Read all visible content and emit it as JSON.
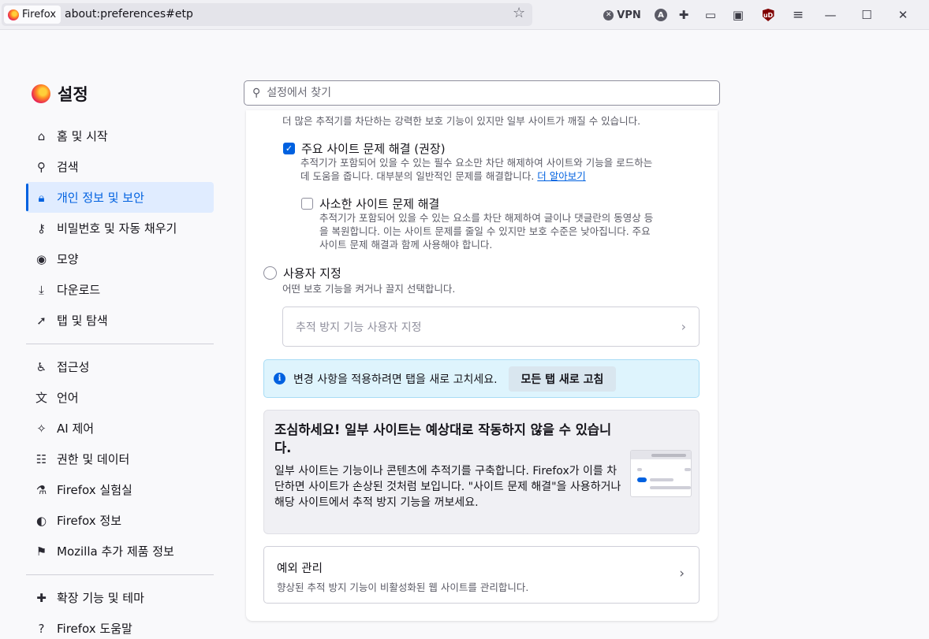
{
  "browser": {
    "identity_label": "Firefox",
    "url": "about:preferences#etp",
    "toolbar": {
      "vpn_label": "VPN",
      "account_initial": "A",
      "ublock_label": "uD"
    },
    "window": {
      "minimize": "—",
      "maximize": "☐",
      "close": "✕"
    }
  },
  "sidebar": {
    "title": "설정",
    "items_top": [
      {
        "label": "홈 및 시작",
        "icon": "home-icon"
      },
      {
        "label": "검색",
        "icon": "search-icon"
      },
      {
        "label": "개인 정보 및 보안",
        "icon": "lock-icon",
        "active": true
      },
      {
        "label": "비밀번호 및 자동 채우기",
        "icon": "key-icon"
      },
      {
        "label": "모양",
        "icon": "eye-icon"
      },
      {
        "label": "다운로드",
        "icon": "download-icon"
      },
      {
        "label": "탭 및 탐색",
        "icon": "cursor-icon"
      }
    ],
    "items_mid": [
      {
        "label": "접근성",
        "icon": "accessibility-icon"
      },
      {
        "label": "언어",
        "icon": "translate-icon"
      },
      {
        "label": "AI 제어",
        "icon": "sparkle-icon"
      },
      {
        "label": "권한 및 데이터",
        "icon": "sliders-icon"
      },
      {
        "label": "Firefox 실험실",
        "icon": "flask-icon"
      },
      {
        "label": "Firefox 정보",
        "icon": "firefox-icon"
      },
      {
        "label": "Mozilla 추가 제품 정보",
        "icon": "mozilla-icon"
      }
    ],
    "items_bottom": [
      {
        "label": "확장 기능 및 테마",
        "icon": "puzzle-icon"
      },
      {
        "label": "Firefox 도움말",
        "icon": "help-icon"
      }
    ]
  },
  "search": {
    "placeholder": "설정에서 찾기"
  },
  "content": {
    "strict_desc": "더 많은 추적기를 차단하는 강력한 보호 기능이 있지만 일부 사이트가 깨질 수 있습니다.",
    "major_fix": {
      "label": "주요 사이트 문제 해결 (권장)",
      "checked": true,
      "desc_line1": "추적기가 포함되어 있을 수 있는 필수 요소만 차단 해제하여 사이트와 기능을 로드하는",
      "desc_line2": "데 도움을 줍니다. 대부분의 일반적인 문제를 해결합니다.",
      "link": "더 알아보기"
    },
    "minor_fix": {
      "label": "사소한 사이트 문제 해결",
      "checked": false,
      "desc_line1": "추적기가 포함되어 있을 수 있는 요소를 차단 해제하여 글이나 댓글란의 동영상 등",
      "desc_line2": "을 복원합니다. 이는 사이트 문제를 줄일 수 있지만 보호 수준은 낮아집니다. 주요",
      "desc_line3": "사이트 문제 해결과 함께 사용해야 합니다."
    },
    "custom": {
      "label": "사용자 지정",
      "desc": "어떤 보호 기능을 켜거나 끌지 선택합니다.",
      "box_label": "추적 방지 기능 사용자 지정"
    },
    "info_bar": {
      "text": "변경 사항을 적용하려면 탭을 새로 고치세요.",
      "button": "모든 탭 새로 고침"
    },
    "warning": {
      "title": "조심하세요! 일부 사이트는 예상대로 작동하지 않을 수 있습니다.",
      "body": "일부 사이트는 기능이나 콘텐츠에 추적기를 구축합니다. Firefox가 이를 차단하면 사이트가 손상된 것처럼 보입니다. \"사이트 문제 해결\"을 사용하거나 해당 사이트에서 추적 방지 기능을 꺼보세요."
    },
    "exceptions": {
      "title": "예외 관리",
      "desc": "향상된 추적 방지 기능이 비활성화된 웹 사이트를 관리합니다."
    }
  },
  "icons": {
    "home-icon": "⌂",
    "search-icon": "⚲",
    "lock-icon": "🔒︎",
    "key-icon": "⚷",
    "eye-icon": "◉",
    "download-icon": "⤓",
    "cursor-icon": "➚",
    "accessibility-icon": "♿︎",
    "translate-icon": "文",
    "sparkle-icon": "✧",
    "sliders-icon": "☷",
    "flask-icon": "⚗",
    "firefox-icon": "◐",
    "mozilla-icon": "⚑",
    "puzzle-icon": "✚",
    "help-icon": "?"
  },
  "colors": {
    "accent": "#0061e0",
    "active_bg": "#e0ecff",
    "info_bg": "#def4fd"
  }
}
